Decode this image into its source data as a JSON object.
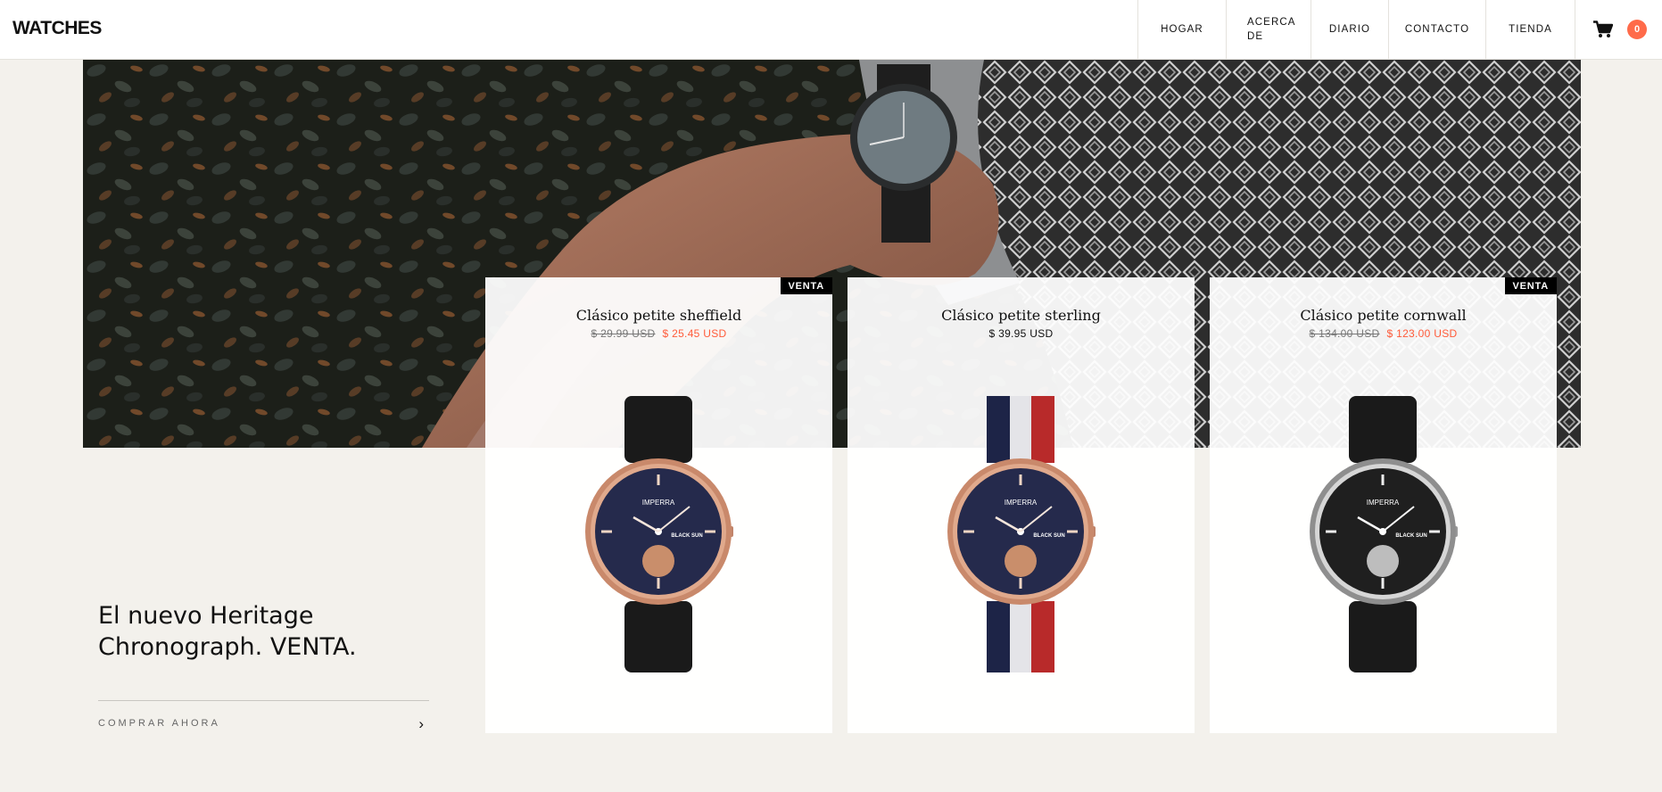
{
  "header": {
    "logo": "WATCHES",
    "nav": [
      "HOGAR",
      "ACERCA DE",
      "DIARIO",
      "CONTACTO",
      "TIENDA"
    ],
    "cart_count": "0"
  },
  "promo": {
    "title": "El nuevo Heritage Chronograph. VENTA.",
    "cta": "COMPRAR AHORA"
  },
  "products": [
    {
      "title": "Clásico petite sheffield",
      "badge": "VENTA",
      "price_old": "$ 29.99 USD",
      "price_new": "$ 25.45 USD",
      "price": "",
      "strap": "black",
      "case": "rose-gold"
    },
    {
      "title": "Clásico petite sterling",
      "badge": "",
      "price_old": "",
      "price_new": "",
      "price": "$ 39.95 USD",
      "strap": "navy-white-red",
      "case": "rose-gold"
    },
    {
      "title": "Clásico petite cornwall",
      "badge": "VENTA",
      "price_old": "$ 134.00 USD",
      "price_new": "$ 123.00 USD",
      "price": "",
      "strap": "black",
      "case": "silver"
    }
  ],
  "watch_face": {
    "brand": "IMPERRA",
    "model": "BLACK SUN"
  },
  "colors": {
    "accent": "#ff6b4a",
    "sale_price": "#ff5b3a",
    "background": "#f3f1ec"
  }
}
